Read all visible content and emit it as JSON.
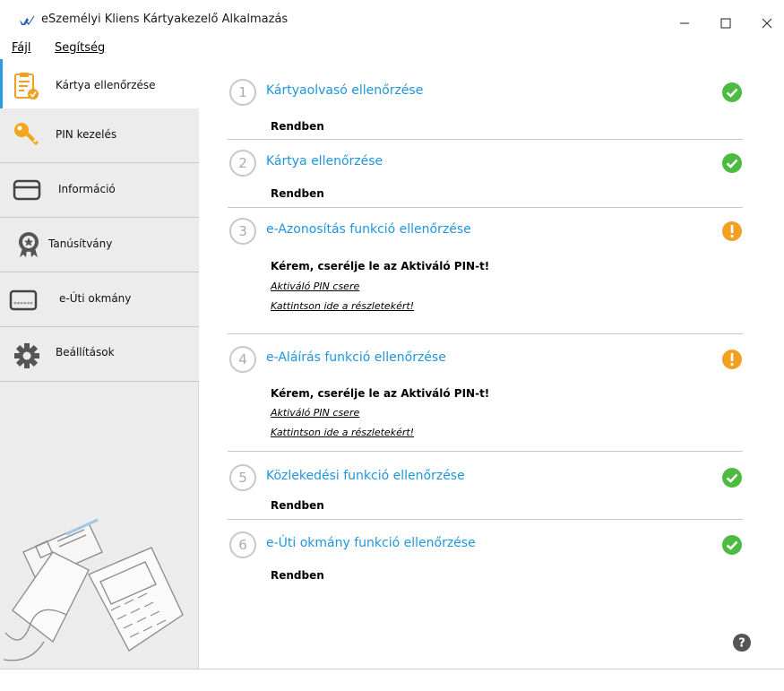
{
  "window": {
    "title": "eSzemélyi Kliens Kártyakezelő Alkalmazás",
    "controls": [
      "minimize-icon",
      "maximize-icon",
      "close-icon"
    ]
  },
  "menu": {
    "file": "Fájl",
    "help": "Segítség"
  },
  "sidebar": {
    "items": [
      {
        "label": "Kártya ellenőrzése",
        "icon": "card-check-icon",
        "active": true
      },
      {
        "label": "PIN kezelés",
        "icon": "key-icon",
        "active": false
      },
      {
        "label": "Információ",
        "icon": "card-info-icon",
        "active": false
      },
      {
        "label": "Tanúsítvány",
        "icon": "certificate-icon",
        "active": false
      },
      {
        "label": "e-Úti okmány",
        "icon": "passport-card-icon",
        "active": false
      },
      {
        "label": "Beállítások",
        "icon": "gear-icon",
        "active": false
      }
    ]
  },
  "checks": [
    {
      "number": "1",
      "title": "Kártyaolvasó ellenőrzése",
      "status": "Rendben",
      "state": "ok",
      "links": []
    },
    {
      "number": "2",
      "title": "Kártya ellenőrzése",
      "status": "Rendben",
      "state": "ok",
      "links": []
    },
    {
      "number": "3",
      "title": "e-Azonosítás funkció ellenőrzése",
      "status": "Kérem, cserélje le az Aktiváló PIN-t!",
      "state": "warning",
      "links": [
        "Aktiváló PIN csere",
        "Kattintson ide a részletekért!"
      ]
    },
    {
      "number": "4",
      "title": "e-Aláírás funkció ellenőrzése",
      "status": "Kérem, cserélje le az Aktiváló PIN-t!",
      "state": "warning",
      "links": [
        "Aktiváló PIN csere",
        "Kattintson ide a részletekért!"
      ]
    },
    {
      "number": "5",
      "title": "Közlekedési funkció ellenőrzése",
      "status": "Rendben",
      "state": "ok",
      "links": []
    },
    {
      "number": "6",
      "title": "e-Úti okmány funkció ellenőrzése",
      "status": "Rendben",
      "state": "ok",
      "links": []
    }
  ],
  "colors": {
    "accent": "#1f95dd",
    "ok": "#4cbb3f",
    "warning": "#f2a024",
    "sidebar_bg": "#ececec"
  },
  "help_icon": "help-icon"
}
